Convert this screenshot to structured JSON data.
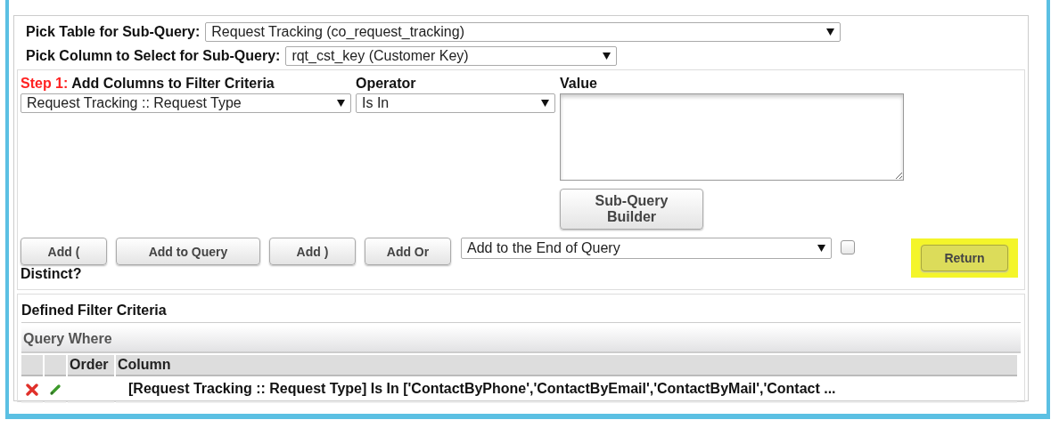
{
  "pick_table": {
    "label": "Pick Table for Sub-Query:",
    "value": "Request Tracking (co_request_tracking)"
  },
  "pick_column": {
    "label": "Pick Column to Select for Sub-Query:",
    "value": "rqt_cst_key (Customer Key)"
  },
  "step": {
    "number": "Step 1:",
    "title": "Add Columns to Filter Criteria"
  },
  "operator_label": "Operator",
  "value_label": "Value",
  "column_select": {
    "value": "Request Tracking :: Request Type"
  },
  "operator_select": {
    "value": "Is In"
  },
  "subquery_button": "Sub-Query Builder",
  "buttons": [
    "Add (",
    "Add to Query",
    "Add )",
    "Add Or"
  ],
  "position_select": {
    "value": "Add to the End of Query"
  },
  "distinct": {
    "label": "Distinct?",
    "checked": false
  },
  "return_button": {
    "label": "Return",
    "highlighted": true
  },
  "filters": {
    "title": "Defined Filter Criteria",
    "group": "Query Where",
    "columns": [
      "Order",
      "Column"
    ],
    "rows": [
      {
        "column": "[Request Tracking :: Request Type] Is In ['ContactByPhone','ContactByEmail','ContactByMail','Contact ..."
      }
    ]
  }
}
